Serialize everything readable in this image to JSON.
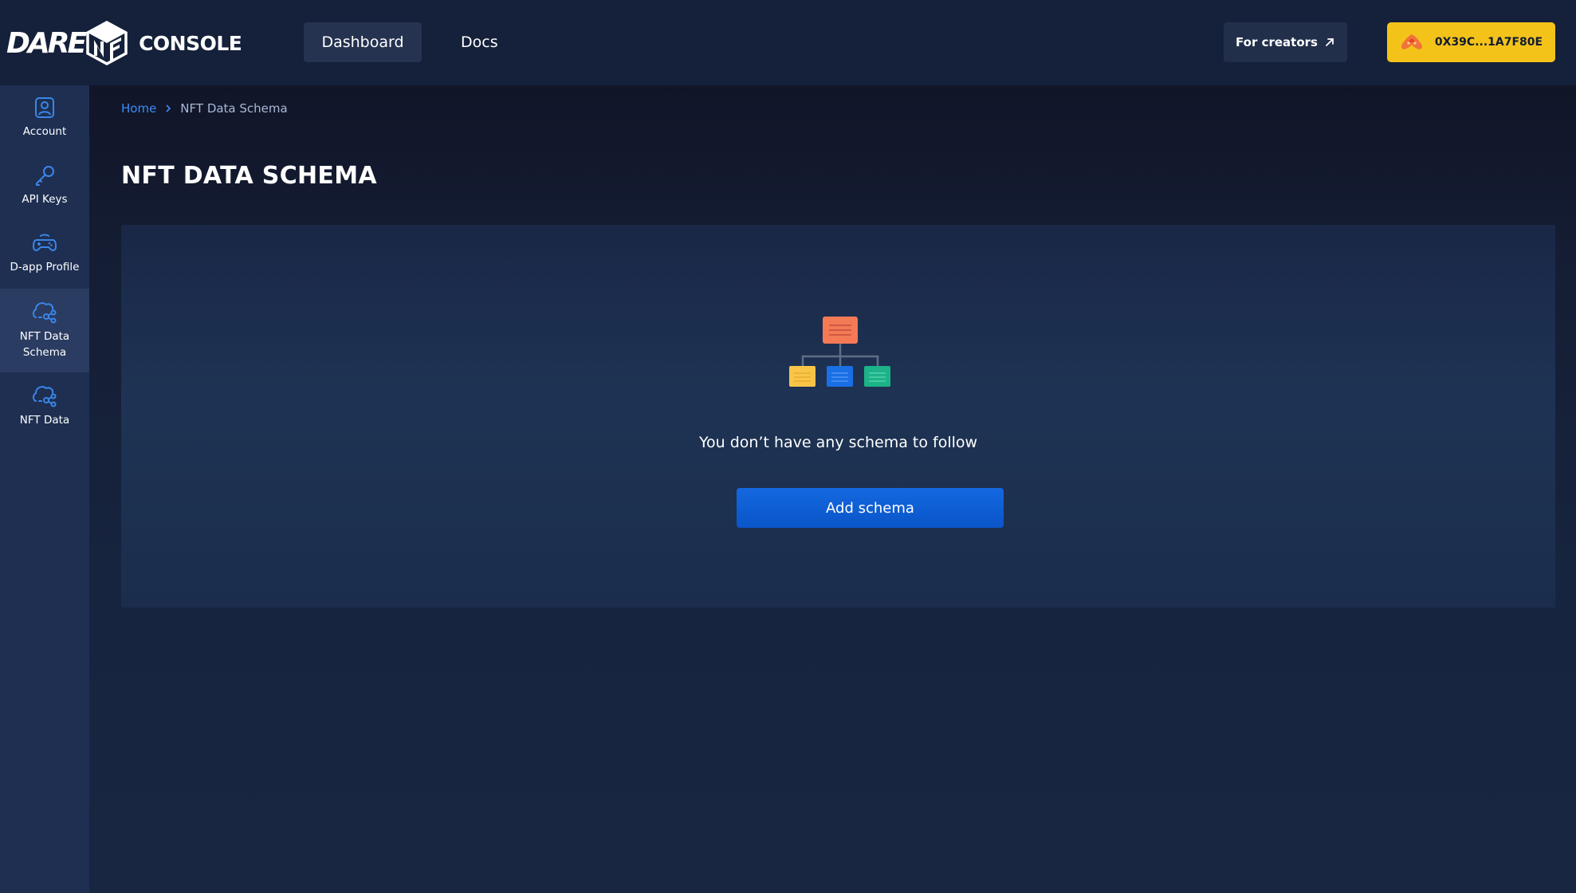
{
  "header": {
    "logo_text": "DARE",
    "console_label": "CONSOLE",
    "nav": [
      {
        "label": "Dashboard"
      },
      {
        "label": "Docs"
      }
    ],
    "creators_label": "For creators",
    "wallet_address": "0X39C...1A7F80E"
  },
  "sidebar": {
    "items": [
      {
        "label": "Account",
        "icon": "account-icon"
      },
      {
        "label": "API Keys",
        "icon": "key-icon"
      },
      {
        "label": "D-app Profile",
        "icon": "gamepad-icon"
      },
      {
        "label": "NFT Data Schema",
        "icon": "nft-schema-icon"
      },
      {
        "label": "NFT Data",
        "icon": "nft-data-icon"
      }
    ],
    "active_index": 3
  },
  "breadcrumb": {
    "home": "Home",
    "current": "NFT Data Schema"
  },
  "main": {
    "title": "NFT DATA SCHEMA",
    "empty_message": "You don’t have any schema to follow",
    "add_button_label": "Add schema"
  },
  "colors": {
    "accent_blue": "#1468e0",
    "wallet_yellow": "#f4c31a",
    "link_blue": "#3a8cf5",
    "schema_orange": "#f47a56",
    "schema_yellow": "#f8c548",
    "schema_blue": "#1a6fe4",
    "schema_green": "#1db388"
  }
}
